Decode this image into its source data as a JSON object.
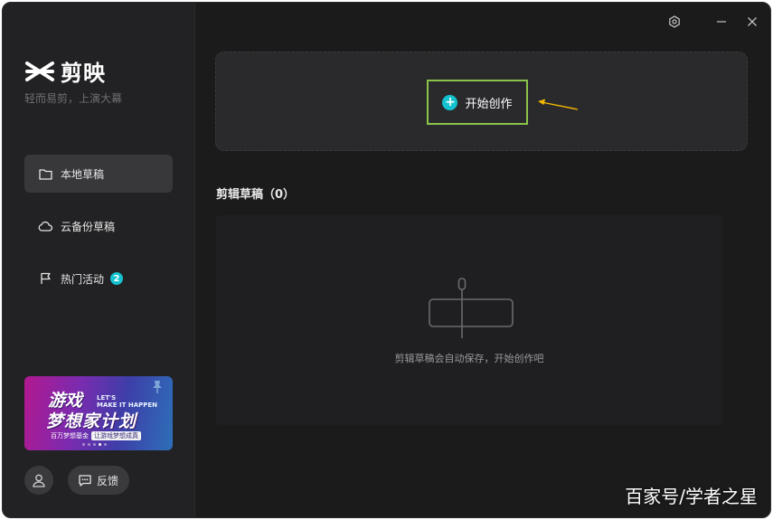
{
  "app": {
    "name": "剪映",
    "slogan": "轻而易剪，上演大幕"
  },
  "sidebar": {
    "items": [
      {
        "label": "本地草稿",
        "icon": "folder-icon",
        "active": true
      },
      {
        "label": "云备份草稿",
        "icon": "cloud-icon",
        "active": false
      },
      {
        "label": "热门活动",
        "icon": "flag-icon",
        "active": false,
        "badge": "2"
      }
    ],
    "banner": {
      "title_line1": "游戏",
      "title_line2": "梦想家计划",
      "en_line1": "LET'S",
      "en_line2": "MAKE IT HAPPEN",
      "footer_left": "百万梦想基金",
      "footer_right": "让游戏梦想成真"
    },
    "feedback_label": "反馈"
  },
  "titlebar": {
    "icons": [
      "settings-icon",
      "minimize-icon",
      "close-icon"
    ]
  },
  "main": {
    "create_label": "开始创作",
    "drafts_title": "剪辑草稿（0）",
    "empty_text": "剪辑草稿会自动保存，开始创作吧"
  },
  "watermark": "百家号/学者之星",
  "colors": {
    "accent": "#14c2cf",
    "highlight_border": "#8bc34a",
    "annotation_arrow": "#f5b800",
    "background": "#1b1b1c",
    "sidebar": "#222224"
  }
}
